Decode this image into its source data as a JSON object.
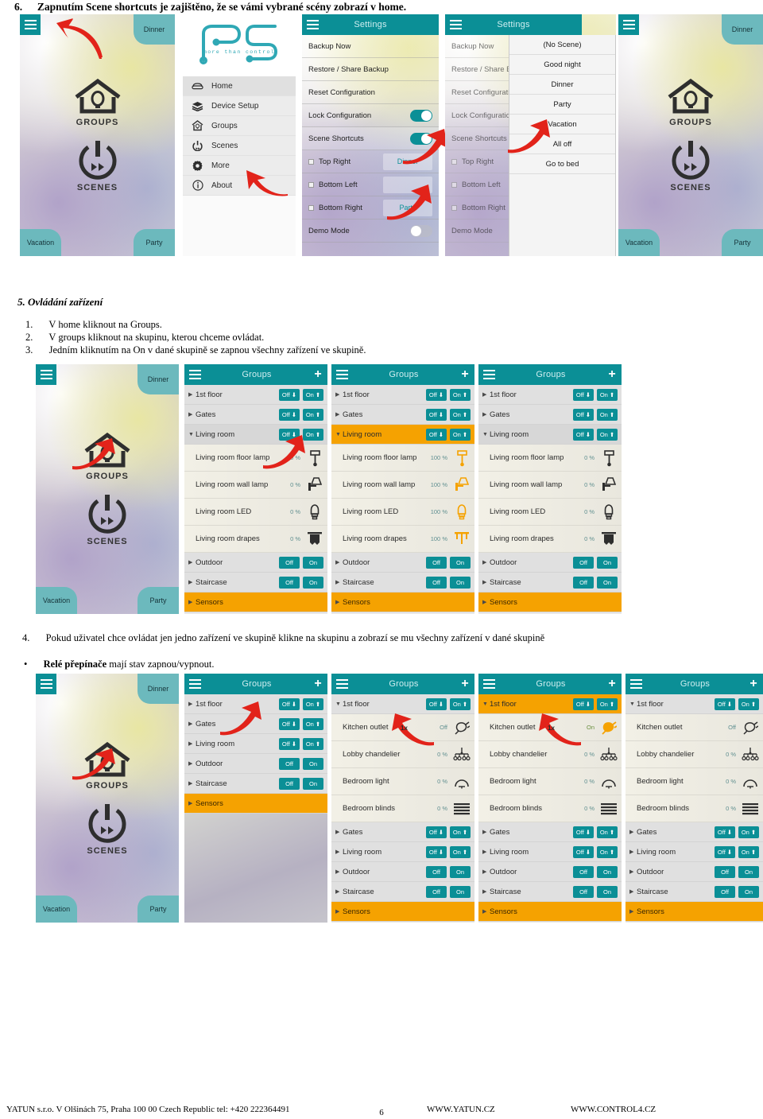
{
  "doc": {
    "step6": {
      "num": "6.",
      "text": "Zapnutím Scene shortcuts je zajištěno, že se vámi vybrané scény zobrazí v home."
    },
    "section5_title": "5. Ovládání zařízení",
    "list1": [
      {
        "num": "1.",
        "text": "V home kliknout na Groups."
      },
      {
        "num": "2.",
        "text": "V groups kliknout na skupinu, kterou chceme ovládat."
      },
      {
        "num": "3.",
        "text": "Jedním kliknutím na On v dané skupině se zapnou všechny zařízení ve skupině."
      }
    ],
    "step4": {
      "num": "4.",
      "text": "Pokud uživatel chce ovládat jen jedno zařízení ve skupině klikne na skupinu a zobrazí se mu všechny zařízení v dané skupině"
    },
    "bullet": {
      "marker": "•",
      "bold": "Relé přepínače",
      "rest": " mají stav zapnou/vypnout."
    }
  },
  "footer": {
    "company": "YATUN s.r.o. V Olšinách 75,  Praha   100 00  Czech Republic  tel: +420  222364491",
    "site1": "WWW.YATUN.CZ",
    "site2": "WWW.CONTROL4.CZ",
    "page": "6"
  },
  "colors": {
    "teal": "#0b8f96",
    "orange": "#f5a201",
    "corner_teal": "#6cb9bd",
    "pct_text": "#5f8f90"
  },
  "home": {
    "groups_label": "GROUPS",
    "scenes_label": "SCENES",
    "corner_top_right": "Dinner",
    "corner_bottom_left": "Vacation",
    "corner_bottom_right": "Party"
  },
  "drawer": {
    "logo_tagline": "more than control",
    "items": [
      {
        "label": "Home",
        "icon": "sofa-icon"
      },
      {
        "label": "Device Setup",
        "icon": "layers-icon"
      },
      {
        "label": "Groups",
        "icon": "house-bulb-icon"
      },
      {
        "label": "Scenes",
        "icon": "power-icon"
      },
      {
        "label": "More",
        "icon": "gear-icon"
      },
      {
        "label": "About",
        "icon": "info-icon"
      }
    ]
  },
  "settings": {
    "title": "Settings",
    "rows": [
      {
        "label": "Backup Now",
        "type": "plain"
      },
      {
        "label": "Restore / Share Backup",
        "type": "plain"
      },
      {
        "label": "Reset Configuration",
        "type": "plain"
      },
      {
        "label": "Lock Configuration",
        "type": "toggle",
        "state": "on"
      },
      {
        "label": "Scene Shortcuts",
        "type": "toggle",
        "state": "on"
      },
      {
        "label": "Top Right",
        "type": "shortcut",
        "value": "Dinner"
      },
      {
        "label": "Bottom Left",
        "type": "shortcut",
        "value": ""
      },
      {
        "label": "Bottom Right",
        "type": "shortcut",
        "value": "Party"
      },
      {
        "label": "Demo Mode",
        "type": "toggle",
        "state": "off"
      }
    ]
  },
  "scene_picker": {
    "options": [
      "(No Scene)",
      "Good night",
      "Dinner",
      "Party",
      "Vacation",
      "All off",
      "Go to bed"
    ]
  },
  "groups": {
    "title": "Groups",
    "add_label": "+",
    "panel_expanded_living": {
      "rows": [
        {
          "label": "1st floor",
          "kind": "group",
          "off": "Off",
          "on": "On",
          "arrows": true,
          "selected": false
        },
        {
          "label": "Gates",
          "kind": "group",
          "off": "Off",
          "on": "On",
          "arrows": true,
          "selected": false
        },
        {
          "label": "Living room",
          "kind": "group",
          "off": "Off",
          "on": "On",
          "arrows": true,
          "selected": false,
          "expanded": true
        },
        {
          "label": "Living room floor lamp",
          "kind": "device",
          "value": "0 %",
          "icon": "floor-lamp-icon"
        },
        {
          "label": "Living room wall lamp",
          "kind": "device",
          "value": "0 %",
          "icon": "wall-lamp-icon"
        },
        {
          "label": "Living room LED",
          "kind": "device",
          "value": "0 %",
          "icon": "led-lamp-icon"
        },
        {
          "label": "Living room drapes",
          "kind": "device",
          "value": "0 %",
          "icon": "drapes-icon"
        },
        {
          "label": "Outdoor",
          "kind": "group",
          "off": "Off",
          "on": "On",
          "arrows": false,
          "selected": false
        },
        {
          "label": "Staircase",
          "kind": "group",
          "off": "Off",
          "on": "On",
          "arrows": false,
          "selected": false
        },
        {
          "label": "Sensors",
          "kind": "orange"
        }
      ]
    },
    "panel_living_on": {
      "rows": [
        {
          "label": "1st floor",
          "kind": "group",
          "off": "Off",
          "on": "On",
          "arrows": true,
          "selected": false
        },
        {
          "label": "Gates",
          "kind": "group",
          "off": "Off",
          "on": "On",
          "arrows": true,
          "selected": false
        },
        {
          "label": "Living room",
          "kind": "group",
          "off": "Off",
          "on": "On",
          "arrows": true,
          "selected": true,
          "expanded": true
        },
        {
          "label": "Living room floor lamp",
          "kind": "device",
          "value": "100 %",
          "icon": "floor-lamp-icon",
          "lit": true
        },
        {
          "label": "Living room wall lamp",
          "kind": "device",
          "value": "100 %",
          "icon": "wall-lamp-icon",
          "lit": true
        },
        {
          "label": "Living room LED",
          "kind": "device",
          "value": "100 %",
          "icon": "led-lamp-icon",
          "lit": true
        },
        {
          "label": "Living room drapes",
          "kind": "device",
          "value": "100 %",
          "icon": "drapes-icon",
          "lit": true
        },
        {
          "label": "Outdoor",
          "kind": "group",
          "off": "Off",
          "on": "On",
          "arrows": false,
          "selected": false
        },
        {
          "label": "Staircase",
          "kind": "group",
          "off": "Off",
          "on": "On",
          "arrows": false,
          "selected": false
        },
        {
          "label": "Sensors",
          "kind": "orange"
        }
      ]
    },
    "panel_collapsed": {
      "rows": [
        {
          "label": "1st floor",
          "kind": "group",
          "off": "Off",
          "on": "On",
          "arrows": true
        },
        {
          "label": "Gates",
          "kind": "group",
          "off": "Off",
          "on": "On",
          "arrows": true
        },
        {
          "label": "Living room",
          "kind": "group",
          "off": "Off",
          "on": "On",
          "arrows": true
        },
        {
          "label": "Outdoor",
          "kind": "group",
          "off": "Off",
          "on": "On",
          "arrows": false
        },
        {
          "label": "Staircase",
          "kind": "group",
          "off": "Off",
          "on": "On",
          "arrows": false
        },
        {
          "label": "Sensors",
          "kind": "orange"
        }
      ]
    },
    "panel_first_floor": {
      "rows": [
        {
          "label": "1st floor",
          "kind": "group",
          "off": "Off",
          "on": "On",
          "arrows": true,
          "expanded": true,
          "selected": false
        },
        {
          "label": "Kitchen outlet",
          "kind": "device",
          "value": "Off",
          "icon": "plug-icon"
        },
        {
          "label": "Lobby chandelier",
          "kind": "device",
          "value": "0 %",
          "icon": "chandelier-icon"
        },
        {
          "label": "Bedroom light",
          "kind": "device",
          "value": "0 %",
          "icon": "dome-light-icon"
        },
        {
          "label": "Bedroom blinds",
          "kind": "device",
          "value": "0 %",
          "icon": "blinds-icon"
        },
        {
          "label": "Gates",
          "kind": "group",
          "off": "Off",
          "on": "On",
          "arrows": true
        },
        {
          "label": "Living room",
          "kind": "group",
          "off": "Off",
          "on": "On",
          "arrows": true
        },
        {
          "label": "Outdoor",
          "kind": "group",
          "off": "Off",
          "on": "On",
          "arrows": false
        },
        {
          "label": "Staircase",
          "kind": "group",
          "off": "Off",
          "on": "On",
          "arrows": false
        },
        {
          "label": "Sensors",
          "kind": "orange"
        }
      ]
    },
    "panel_first_floor_on": {
      "rows": [
        {
          "label": "1st floor",
          "kind": "group",
          "off": "Off",
          "on": "On",
          "arrows": true,
          "expanded": true,
          "selected": true
        },
        {
          "label": "Kitchen outlet",
          "kind": "device",
          "value": "On",
          "icon": "plug-icon",
          "lit": true
        },
        {
          "label": "Lobby chandelier",
          "kind": "device",
          "value": "0 %",
          "icon": "chandelier-icon"
        },
        {
          "label": "Bedroom light",
          "kind": "device",
          "value": "0 %",
          "icon": "dome-light-icon"
        },
        {
          "label": "Bedroom blinds",
          "kind": "device",
          "value": "0 %",
          "icon": "blinds-icon"
        },
        {
          "label": "Gates",
          "kind": "group",
          "off": "Off",
          "on": "On",
          "arrows": true
        },
        {
          "label": "Living room",
          "kind": "group",
          "off": "Off",
          "on": "On",
          "arrows": true
        },
        {
          "label": "Outdoor",
          "kind": "group",
          "off": "Off",
          "on": "On",
          "arrows": false
        },
        {
          "label": "Staircase",
          "kind": "group",
          "off": "Off",
          "on": "On",
          "arrows": false
        },
        {
          "label": "Sensors",
          "kind": "orange"
        }
      ]
    },
    "annotation_1x": "1x"
  }
}
